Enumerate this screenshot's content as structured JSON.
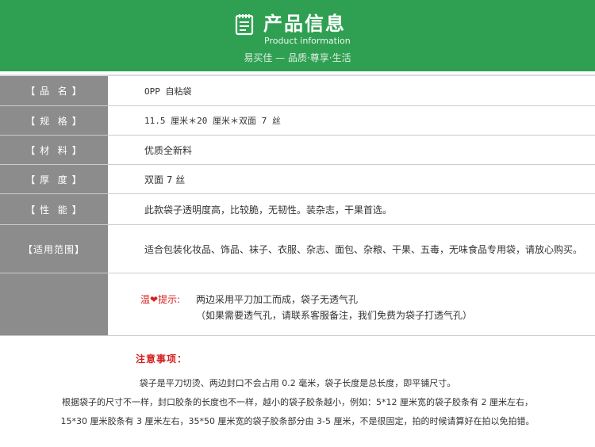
{
  "header": {
    "title": "产品信息",
    "subtitle": "Product information",
    "slogan": "易买佳 — 品质·尊享·生活",
    "icon": "document-icon"
  },
  "colors": {
    "header_bg": "#2fa052",
    "label_bg": "#8c8c8c",
    "accent_red": "#d62020"
  },
  "specs": [
    {
      "label": "【 品  名 】",
      "value": "OPP 自粘袋"
    },
    {
      "label": "【 规  格 】",
      "value": "11.5 厘米＊20 厘米＊双面 7 丝"
    },
    {
      "label": "【 材  料 】",
      "value": "优质全新料"
    },
    {
      "label": "【 厚  度 】",
      "value": "双面 7 丝"
    },
    {
      "label": "【 性  能 】",
      "value": "此款袋子透明度高，比较脆，无韧性。装杂志，干果首选。"
    },
    {
      "label": "【适用范围】",
      "value": "适合包装化妆品、饰品、袜子、衣服、杂志、面包、杂粮、干果、五毒，无味食品专用袋，请放心购买。"
    }
  ],
  "tips": {
    "prefix_left": "温",
    "prefix_right": "提示:",
    "line1": "两边采用平刀加工而成，袋子无透气孔",
    "line2": "（如果需要透气孔，请联系客服备注，我们免费为袋子打透气孔）"
  },
  "notes": {
    "title": "注意事项：",
    "lines": [
      "袋子是平刀切烫、两边封口不会占用 0.2 毫米，袋子长度是总长度，即平铺尺寸。",
      "根据袋子的尺寸不一样，封口胶条的长度也不一样，越小的袋子胶条越小，例如：5*12 厘米宽的袋子胶条有 2 厘米左右，",
      "15*30 厘米胶条有 3 厘米左右，35*50 厘米宽的袋子胶条部分由 3-5 厘米，不是很固定，拍的时候请算好在拍以免拍错。"
    ]
  }
}
